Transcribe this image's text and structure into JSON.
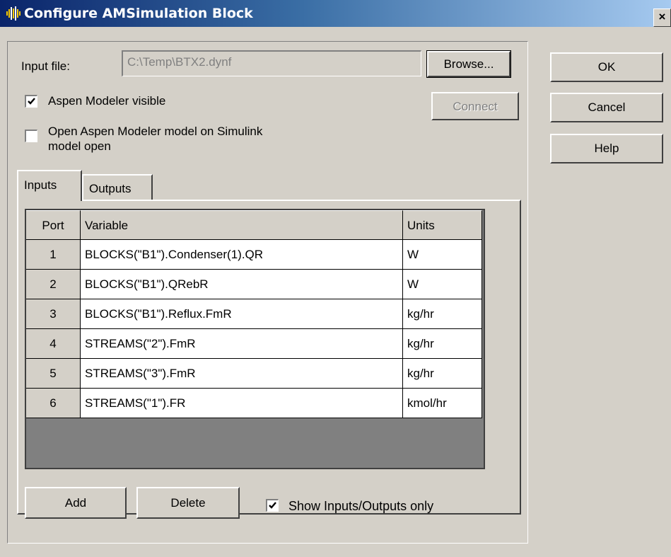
{
  "window": {
    "title": "Configure AMSimulation Block",
    "close_glyph": "×"
  },
  "form": {
    "input_file_label": "Input file:",
    "input_file_value": "C:\\Temp\\BTX2.dynf",
    "browse_label": "Browse...",
    "connect_label": "Connect",
    "visible_label": "Aspen Modeler visible",
    "visible_checked": true,
    "open_model_line1": "Open Aspen Modeler model on Simulink",
    "open_model_line2": "model open",
    "open_model_checked": false
  },
  "side_buttons": {
    "ok": "OK",
    "cancel": "Cancel",
    "help": "Help"
  },
  "tabs": [
    {
      "label": "Inputs",
      "active": true
    },
    {
      "label": "Outputs",
      "active": false
    }
  ],
  "table": {
    "headers": {
      "port": "Port",
      "variable": "Variable",
      "units": "Units"
    },
    "rows": [
      {
        "port": "1",
        "variable": "BLOCKS(\"B1\").Condenser(1).QR",
        "units": "W"
      },
      {
        "port": "2",
        "variable": "BLOCKS(\"B1\").QRebR",
        "units": "W"
      },
      {
        "port": "3",
        "variable": "BLOCKS(\"B1\").Reflux.FmR",
        "units": "kg/hr"
      },
      {
        "port": "4",
        "variable": "STREAMS(\"2\").FmR",
        "units": "kg/hr"
      },
      {
        "port": "5",
        "variable": "STREAMS(\"3\").FmR",
        "units": "kg/hr"
      },
      {
        "port": "6",
        "variable": "STREAMS(\"1\").FR",
        "units": "kmol/hr"
      }
    ]
  },
  "bottom": {
    "add_label": "Add",
    "delete_label": "Delete",
    "show_only_label": "Show Inputs/Outputs only",
    "show_only_checked": true
  },
  "icons": {
    "app_icon": "equalizer-bars-icon",
    "check_icon": "checkmark-icon"
  },
  "colors": {
    "title_start": "#0a246a",
    "title_end": "#a6caf0",
    "face": "#d4d0c8",
    "grid_background": "#808080"
  }
}
